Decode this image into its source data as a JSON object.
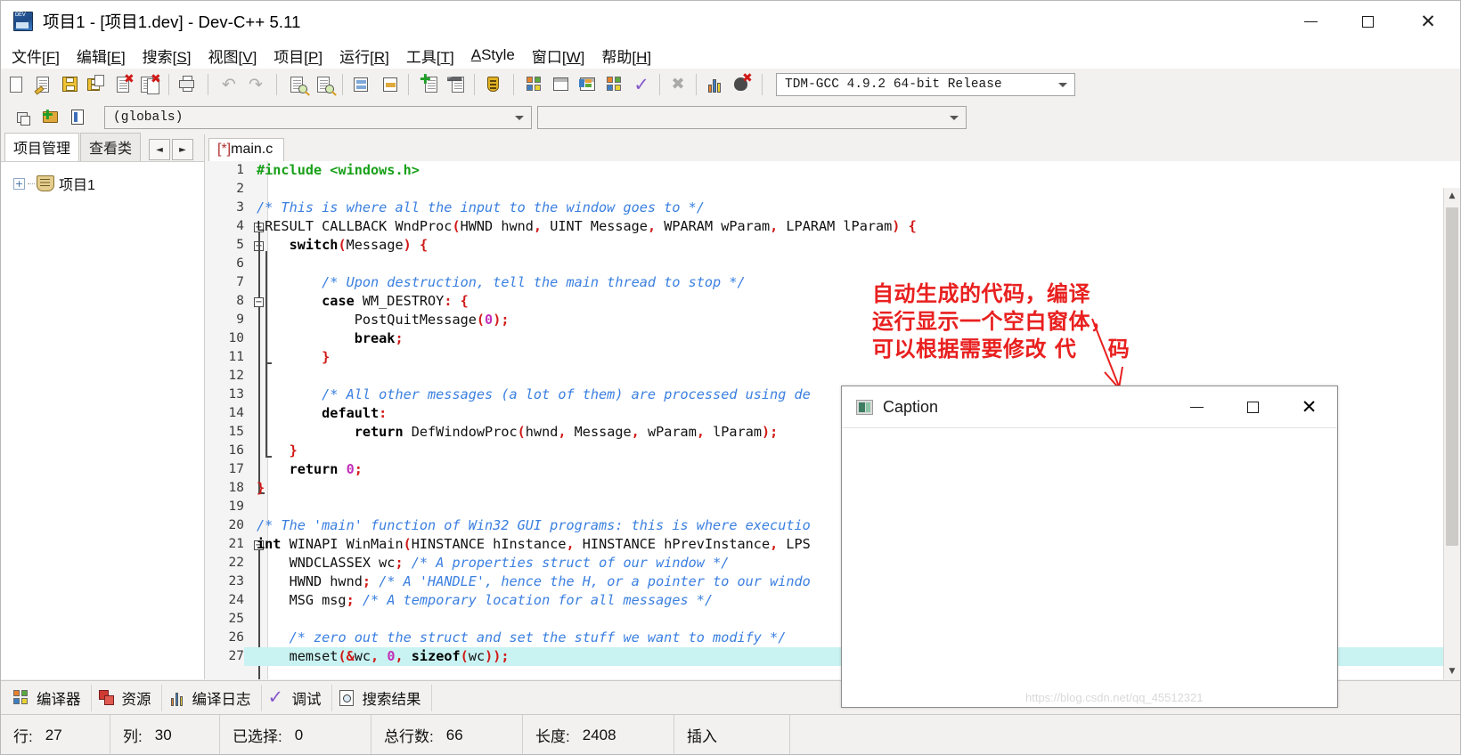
{
  "window": {
    "title": "项目1 - [项目1.dev] - Dev-C++ 5.11",
    "icon": "dev-cpp-icon",
    "minimize": "−",
    "maximize": "□",
    "close": "✕"
  },
  "menubar": [
    {
      "label": "文件",
      "accel": "F"
    },
    {
      "label": "编辑",
      "accel": "E"
    },
    {
      "label": "搜索",
      "accel": "S"
    },
    {
      "label": "视图",
      "accel": "V"
    },
    {
      "label": "项目",
      "accel": "P"
    },
    {
      "label": "运行",
      "accel": "R"
    },
    {
      "label": "工具",
      "accel": "T"
    },
    {
      "label": "AStyle",
      "accel": ""
    },
    {
      "label": "窗口",
      "accel": "W"
    },
    {
      "label": "帮助",
      "accel": "H"
    }
  ],
  "toolbar": {
    "compiler_profile": "TDM-GCC 4.9.2 64-bit Release",
    "buttons": [
      "new-file-icon",
      "open-file-icon",
      "save-icon",
      "save-all-icon",
      "close-file-icon",
      "close-all-icon",
      "print-icon",
      "undo-icon",
      "redo-icon",
      "find-icon",
      "replace-icon",
      "toggle-panel-icon",
      "goto-line-icon",
      "add-to-project-icon",
      "remove-from-project-icon",
      "project-options-icon",
      "compile-icon",
      "run-icon",
      "compile-run-icon",
      "rebuild-all-icon",
      "syntax-check-icon",
      "stop-icon",
      "profile-icon",
      "debug-icon"
    ]
  },
  "toolbar2": {
    "buttons": [
      "new-class-icon",
      "new-member-icon",
      "browse-icon"
    ],
    "scope_combo": "(globals)",
    "member_combo": ""
  },
  "left_panel": {
    "tabs": [
      {
        "label": "项目管理",
        "active": true
      },
      {
        "label": "查看类",
        "active": false
      }
    ],
    "nav_prev": "◄",
    "nav_next": "►",
    "tree": [
      {
        "label": "项目1",
        "expander": "+",
        "icon": "project-icon"
      }
    ]
  },
  "editor": {
    "tabs": [
      {
        "modified": "[*]",
        "filename": "main.c",
        "active": true
      }
    ],
    "lines": [
      {
        "n": 1,
        "tokens": [
          {
            "t": "#include ",
            "c": "pp"
          },
          {
            "t": "<windows.h>",
            "c": "pp"
          }
        ]
      },
      {
        "n": 2,
        "tokens": []
      },
      {
        "n": 3,
        "tokens": [
          {
            "t": "/* This is where all the input to the window goes to */",
            "c": "cm"
          }
        ]
      },
      {
        "n": 4,
        "tokens": [
          {
            "t": "LRESULT CALLBACK WndProc",
            "c": "id"
          },
          {
            "t": "(",
            "c": "pn"
          },
          {
            "t": "HWND hwnd",
            "c": "id"
          },
          {
            "t": ",",
            "c": "pn"
          },
          {
            "t": " UINT Message",
            "c": "id"
          },
          {
            "t": ",",
            "c": "pn"
          },
          {
            "t": " WPARAM wParam",
            "c": "id"
          },
          {
            "t": ",",
            "c": "pn"
          },
          {
            "t": " LPARAM lParam",
            "c": "id"
          },
          {
            "t": ")",
            "c": "pn"
          },
          {
            "t": " ",
            "c": "id"
          },
          {
            "t": "{",
            "c": "pn"
          }
        ]
      },
      {
        "n": 5,
        "tokens": [
          {
            "t": "    ",
            "c": "id"
          },
          {
            "t": "switch",
            "c": "k"
          },
          {
            "t": "(",
            "c": "pn"
          },
          {
            "t": "Message",
            "c": "id"
          },
          {
            "t": ")",
            "c": "pn"
          },
          {
            "t": " ",
            "c": "id"
          },
          {
            "t": "{",
            "c": "pn"
          }
        ]
      },
      {
        "n": 6,
        "tokens": []
      },
      {
        "n": 7,
        "tokens": [
          {
            "t": "        ",
            "c": "id"
          },
          {
            "t": "/* Upon destruction, tell the main thread to stop */",
            "c": "cm"
          }
        ]
      },
      {
        "n": 8,
        "tokens": [
          {
            "t": "        ",
            "c": "id"
          },
          {
            "t": "case",
            "c": "k"
          },
          {
            "t": " WM_DESTROY",
            "c": "id"
          },
          {
            "t": ":",
            "c": "pn"
          },
          {
            "t": " ",
            "c": "id"
          },
          {
            "t": "{",
            "c": "pn"
          }
        ]
      },
      {
        "n": 9,
        "tokens": [
          {
            "t": "            PostQuitMessage",
            "c": "id"
          },
          {
            "t": "(",
            "c": "pn"
          },
          {
            "t": "0",
            "c": "nu"
          },
          {
            "t": ");",
            "c": "pn"
          }
        ]
      },
      {
        "n": 10,
        "tokens": [
          {
            "t": "            ",
            "c": "id"
          },
          {
            "t": "break",
            "c": "k"
          },
          {
            "t": ";",
            "c": "pn"
          }
        ]
      },
      {
        "n": 11,
        "tokens": [
          {
            "t": "        ",
            "c": "id"
          },
          {
            "t": "}",
            "c": "pn"
          }
        ]
      },
      {
        "n": 12,
        "tokens": []
      },
      {
        "n": 13,
        "tokens": [
          {
            "t": "        ",
            "c": "id"
          },
          {
            "t": "/* All other messages (a lot of them) are processed using de",
            "c": "cm"
          }
        ]
      },
      {
        "n": 14,
        "tokens": [
          {
            "t": "        ",
            "c": "id"
          },
          {
            "t": "default",
            "c": "k"
          },
          {
            "t": ":",
            "c": "pn"
          }
        ]
      },
      {
        "n": 15,
        "tokens": [
          {
            "t": "            ",
            "c": "id"
          },
          {
            "t": "return",
            "c": "k"
          },
          {
            "t": " DefWindowProc",
            "c": "id"
          },
          {
            "t": "(",
            "c": "pn"
          },
          {
            "t": "hwnd",
            "c": "id"
          },
          {
            "t": ",",
            "c": "pn"
          },
          {
            "t": " Message",
            "c": "id"
          },
          {
            "t": ",",
            "c": "pn"
          },
          {
            "t": " wParam",
            "c": "id"
          },
          {
            "t": ",",
            "c": "pn"
          },
          {
            "t": " lParam",
            "c": "id"
          },
          {
            "t": ");",
            "c": "pn"
          }
        ]
      },
      {
        "n": 16,
        "tokens": [
          {
            "t": "    ",
            "c": "id"
          },
          {
            "t": "}",
            "c": "pn"
          }
        ]
      },
      {
        "n": 17,
        "tokens": [
          {
            "t": "    ",
            "c": "id"
          },
          {
            "t": "return",
            "c": "k"
          },
          {
            "t": " ",
            "c": "id"
          },
          {
            "t": "0",
            "c": "nu"
          },
          {
            "t": ";",
            "c": "pn"
          }
        ]
      },
      {
        "n": 18,
        "tokens": [
          {
            "t": "}",
            "c": "pn"
          }
        ]
      },
      {
        "n": 19,
        "tokens": []
      },
      {
        "n": 20,
        "tokens": [
          {
            "t": "/* The 'main' function of Win32 GUI programs: this is where executio",
            "c": "cm"
          }
        ]
      },
      {
        "n": 21,
        "tokens": [
          {
            "t": "int",
            "c": "k"
          },
          {
            "t": " WINAPI WinMain",
            "c": "id"
          },
          {
            "t": "(",
            "c": "pn"
          },
          {
            "t": "HINSTANCE hInstance",
            "c": "id"
          },
          {
            "t": ",",
            "c": "pn"
          },
          {
            "t": " HINSTANCE hPrevInstance",
            "c": "id"
          },
          {
            "t": ",",
            "c": "pn"
          },
          {
            "t": " LPS",
            "c": "id"
          }
        ]
      },
      {
        "n": 22,
        "tokens": [
          {
            "t": "    WNDCLASSEX wc",
            "c": "id"
          },
          {
            "t": ";",
            "c": "pn"
          },
          {
            "t": " ",
            "c": "id"
          },
          {
            "t": "/* A properties struct of our window */",
            "c": "cm"
          }
        ]
      },
      {
        "n": 23,
        "tokens": [
          {
            "t": "    HWND hwnd",
            "c": "id"
          },
          {
            "t": ";",
            "c": "pn"
          },
          {
            "t": " ",
            "c": "id"
          },
          {
            "t": "/* A 'HANDLE', hence the H, or a pointer to our windo",
            "c": "cm"
          }
        ]
      },
      {
        "n": 24,
        "tokens": [
          {
            "t": "    MSG msg",
            "c": "id"
          },
          {
            "t": ";",
            "c": "pn"
          },
          {
            "t": " ",
            "c": "id"
          },
          {
            "t": "/* A temporary location for all messages */",
            "c": "cm"
          }
        ]
      },
      {
        "n": 25,
        "tokens": []
      },
      {
        "n": 26,
        "tokens": [
          {
            "t": "    ",
            "c": "id"
          },
          {
            "t": "/* zero out the struct and set the stuff we want to modify */",
            "c": "cm"
          }
        ]
      },
      {
        "n": 27,
        "tokens": [
          {
            "t": "    memset",
            "c": "id"
          },
          {
            "t": "(&",
            "c": "pn"
          },
          {
            "t": "wc",
            "c": "id"
          },
          {
            "t": ", ",
            "c": "pn"
          },
          {
            "t": "0",
            "c": "nu"
          },
          {
            "t": ", ",
            "c": "pn"
          },
          {
            "t": "sizeof",
            "c": "k"
          },
          {
            "t": "(",
            "c": "pn"
          },
          {
            "t": "wc",
            "c": "id"
          },
          {
            "t": "));",
            "c": "pn"
          }
        ],
        "highlight": true
      }
    ]
  },
  "annotation": {
    "line1": "自动生成的代码，编译",
    "line2": "运行显示一个空白窗体，",
    "line3": "可以根据需要修改 代    码",
    "color": "#e8201f",
    "arrow": "down-left-arrow"
  },
  "caption_window": {
    "title": "Caption",
    "icon": "app-icon",
    "minimize": "−",
    "maximize": "□",
    "close": "✕"
  },
  "watermark": "https://blog.csdn.net/qq_45512321",
  "bottom_tabs": [
    {
      "label": "编译器",
      "icon": "compiler-icon"
    },
    {
      "label": "资源",
      "icon": "resources-icon"
    },
    {
      "label": "编译日志",
      "icon": "build-log-icon"
    },
    {
      "label": "调试",
      "icon": "debug-icon"
    },
    {
      "label": "搜索结果",
      "icon": "search-results-icon"
    }
  ],
  "statusbar": [
    {
      "label": "行:",
      "value": "27"
    },
    {
      "label": "列:",
      "value": "30"
    },
    {
      "label": "已选择:",
      "value": "0"
    },
    {
      "label": "总行数:",
      "value": "66"
    },
    {
      "label": "长度:",
      "value": "2408"
    },
    {
      "label": "插入",
      "value": ""
    }
  ]
}
